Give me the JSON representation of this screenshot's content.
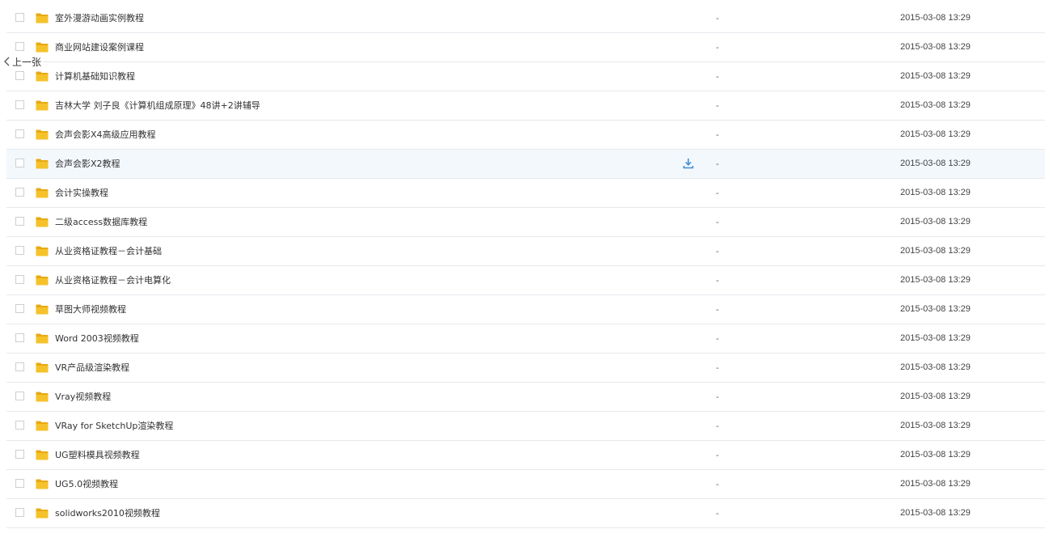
{
  "nav": {
    "prev_label": "上一张",
    "prev_icon": "chevron-left-icon"
  },
  "colors": {
    "folder": "#f5c22a",
    "folder_dark": "#e8a913",
    "hover_row": "#f3f8fd",
    "download": "#3b8fd9",
    "divider": "#e6e9ee"
  },
  "icons": {
    "folder": "folder-icon",
    "download": "download-icon",
    "checkbox": "checkbox"
  },
  "files": [
    {
      "name": "室外漫游动画实例教程",
      "size": "-",
      "date": "2015-03-08 13:29"
    },
    {
      "name": "商业网站建设案例课程",
      "size": "-",
      "date": "2015-03-08 13:29"
    },
    {
      "name": "计算机基础知识教程",
      "size": "-",
      "date": "2015-03-08 13:29"
    },
    {
      "name": "吉林大学 刘子良《计算机组成原理》48讲+2讲辅导",
      "size": "-",
      "date": "2015-03-08 13:29"
    },
    {
      "name": "会声会影X4高级应用教程",
      "size": "-",
      "date": "2015-03-08 13:29"
    },
    {
      "name": "会声会影X2教程",
      "size": "-",
      "date": "2015-03-08 13:29",
      "hovered": true
    },
    {
      "name": "会计实操教程",
      "size": "-",
      "date": "2015-03-08 13:29"
    },
    {
      "name": "二级access数据库教程",
      "size": "-",
      "date": "2015-03-08 13:29"
    },
    {
      "name": "从业资格证教程－会计基础",
      "size": "-",
      "date": "2015-03-08 13:29"
    },
    {
      "name": "从业资格证教程－会计电算化",
      "size": "-",
      "date": "2015-03-08 13:29"
    },
    {
      "name": "草图大师视频教程",
      "size": "-",
      "date": "2015-03-08 13:29"
    },
    {
      "name": "Word 2003视频教程",
      "size": "-",
      "date": "2015-03-08 13:29"
    },
    {
      "name": "VR产品级渲染教程",
      "size": "-",
      "date": "2015-03-08 13:29"
    },
    {
      "name": "Vray视频教程",
      "size": "-",
      "date": "2015-03-08 13:29"
    },
    {
      "name": "VRay for SketchUp渲染教程",
      "size": "-",
      "date": "2015-03-08 13:29"
    },
    {
      "name": "UG塑料模具视频教程",
      "size": "-",
      "date": "2015-03-08 13:29"
    },
    {
      "name": "UG5.0视频教程",
      "size": "-",
      "date": "2015-03-08 13:29"
    },
    {
      "name": "solidworks2010视频教程",
      "size": "-",
      "date": "2015-03-08 13:29"
    }
  ]
}
